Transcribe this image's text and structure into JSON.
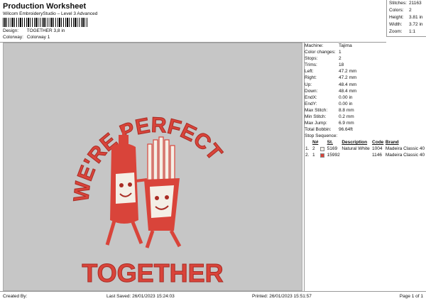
{
  "header": {
    "title": "Production Worksheet",
    "subtitle": "Wilcom EmbroideryStudio – Level 3 Advanced",
    "design_label": "Design:",
    "design_value": "TOGETHER 3,8 in",
    "colorway_label": "Colorway:",
    "colorway_value": "Colorway 1"
  },
  "stats": [
    {
      "label": "Stitches:",
      "value": "21163"
    },
    {
      "label": "Colors:",
      "value": "2"
    },
    {
      "label": "Height:",
      "value": "3.81 in"
    },
    {
      "label": "Width:",
      "value": "3.72 in"
    },
    {
      "label": "Zoom:",
      "value": "1:1"
    }
  ],
  "design": {
    "top_text": "WE'RE PERFECT",
    "bottom_text": "TOGETHER",
    "thread_color": "#d9443a",
    "background_color": "#c6c6c6"
  },
  "info": [
    {
      "label": "Machine:",
      "value": "Tajima"
    },
    {
      "label": "Color changes:",
      "value": "1"
    },
    {
      "label": "Stops:",
      "value": "2"
    },
    {
      "label": "Trims:",
      "value": "18"
    },
    {
      "label": "Left:",
      "value": "47.2 mm"
    },
    {
      "label": "Right:",
      "value": "47.2 mm"
    },
    {
      "label": "Up:",
      "value": "48.4 mm"
    },
    {
      "label": "Down:",
      "value": "48.4 mm"
    },
    {
      "label": "EndX:",
      "value": "0.00 in"
    },
    {
      "label": "EndY:",
      "value": "0.00 in"
    },
    {
      "label": "Max Stitch:",
      "value": "8.8 mm"
    },
    {
      "label": "Min Stitch:",
      "value": "0.2 mm"
    },
    {
      "label": "Max Jump:",
      "value": "6.9 mm"
    },
    {
      "label": "Total Bobbin:",
      "value": "96.64ft"
    }
  ],
  "sequence": {
    "title": "Stop Sequence:",
    "headers": [
      "N#",
      "St.",
      "Description",
      "Code",
      "Brand"
    ],
    "rows": [
      {
        "index": "1.",
        "n": "2",
        "color": "#f2f0ea",
        "st": "5169",
        "desc": "Natural White",
        "code": "1004",
        "brand": "Madeira Classic 40"
      },
      {
        "index": "2.",
        "n": "1",
        "color": "#d9443a",
        "st": "15992",
        "desc": "",
        "code": "1146",
        "brand": "Madeira Classic 40"
      }
    ]
  },
  "footer": {
    "created_by": "Created By:",
    "last_saved": "Last Saved: 26/01/2023 15:24:03",
    "printed": "Printed: 26/01/2023 15:51:57",
    "page": "Page 1 of 1"
  }
}
